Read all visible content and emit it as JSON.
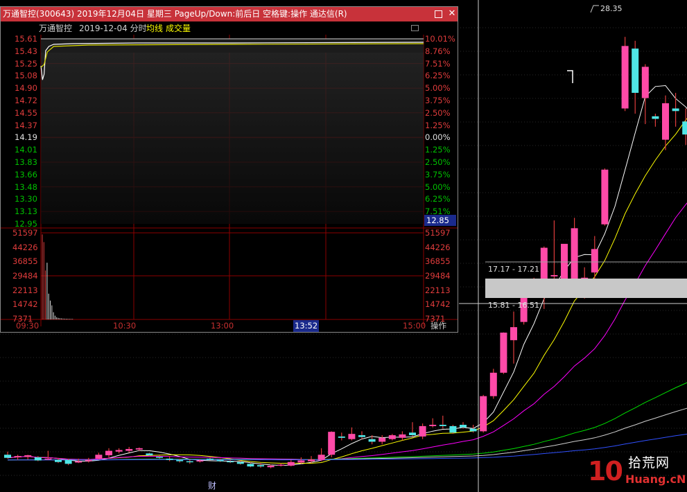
{
  "window": {
    "title": "万通智控(300643) 2019年12月04日 星期三 PageUp/Down:前后日 空格键:操作 通达信(R)",
    "restore_icon": "restore-icon",
    "close_label": "✕"
  },
  "intraday": {
    "stock_name": "万通智控",
    "date": "2019-12-04",
    "mode_label": "分时",
    "avg_label": "均线",
    "vol_label": "成交量",
    "current_price": "12.85",
    "current_time": "13:52",
    "op_label": "操作",
    "colors": {
      "up": "#e03c3c",
      "down": "#00c000",
      "flat": "#ffffff",
      "price_line": "#ffffff",
      "avg_line": "#e0e000",
      "grid": "#8c0000"
    }
  },
  "chart_data": [
    {
      "type": "line",
      "title": "",
      "xlabel": "",
      "ylabel": "",
      "x_ticks": [
        "09:30",
        "10:30",
        "13:00",
        "15:00"
      ],
      "price_ticks": [
        "15.61",
        "15.43",
        "15.25",
        "15.08",
        "14.90",
        "14.72",
        "14.55",
        "14.37",
        "14.19",
        "14.01",
        "13.83",
        "13.66",
        "13.48",
        "13.30",
        "13.13",
        "12.95"
      ],
      "pct_ticks": [
        "10.01%",
        "8.76%",
        "7.51%",
        "6.25%",
        "5.00%",
        "3.75%",
        "2.50%",
        "1.25%",
        "0.00%",
        "1.25%",
        "2.50%",
        "3.75%",
        "5.00%",
        "6.25%",
        "7.51%",
        ""
      ],
      "prev_close": 14.19,
      "ylim": [
        12.95,
        15.61
      ],
      "series": [
        {
          "name": "",
          "points": [
            [
              0,
              15.22
            ],
            [
              1,
              15.02
            ],
            [
              2,
              15.1
            ],
            [
              3,
              15.44
            ],
            [
              5,
              15.5
            ],
            [
              8,
              15.53
            ],
            [
              20,
              15.54
            ],
            [
              60,
              15.55
            ],
            [
              120,
              15.55
            ],
            [
              240,
              15.56
            ]
          ]
        },
        {
          "name": "均线",
          "points": [
            [
              0,
              15.2
            ],
            [
              2,
              15.24
            ],
            [
              4,
              15.42
            ],
            [
              8,
              15.5
            ],
            [
              30,
              15.52
            ],
            [
              120,
              15.53
            ],
            [
              240,
              15.54
            ]
          ]
        }
      ],
      "volume_ticks": [
        "51597",
        "44226",
        "36855",
        "29484",
        "22113",
        "14742",
        "7371"
      ],
      "volume_max": 51597,
      "volume_bars": [
        49500,
        45000,
        28500,
        33000,
        15000,
        11000,
        8200,
        4200,
        2200,
        1300,
        900,
        700,
        600,
        500,
        450,
        400,
        380,
        350,
        330,
        300
      ]
    },
    {
      "type": "candlestick",
      "title": "",
      "ylim": [
        11.8,
        29.5
      ],
      "price_annotations": [
        "28.35",
        "17.17 - 17.21",
        "15.81 - 16.51"
      ],
      "candles": [
        {
          "o": 12.3,
          "h": 12.42,
          "l": 12.15,
          "c": 12.18
        },
        {
          "o": 12.2,
          "h": 12.3,
          "l": 12.1,
          "c": 12.25
        },
        {
          "o": 12.22,
          "h": 12.3,
          "l": 12.12,
          "c": 12.28
        },
        {
          "o": 12.2,
          "h": 12.25,
          "l": 12.05,
          "c": 12.08
        },
        {
          "o": 12.12,
          "h": 12.45,
          "l": 12.1,
          "c": 12.15
        },
        {
          "o": 12.1,
          "h": 12.18,
          "l": 11.98,
          "c": 12.02
        },
        {
          "o": 12.1,
          "h": 12.15,
          "l": 11.9,
          "c": 11.95
        },
        {
          "o": 12.0,
          "h": 12.15,
          "l": 11.98,
          "c": 12.05
        },
        {
          "o": 12.05,
          "h": 12.18,
          "l": 12.0,
          "c": 12.1
        },
        {
          "o": 12.15,
          "h": 12.38,
          "l": 12.12,
          "c": 12.3
        },
        {
          "o": 12.28,
          "h": 12.55,
          "l": 12.2,
          "c": 12.45
        },
        {
          "o": 12.42,
          "h": 12.55,
          "l": 12.35,
          "c": 12.48
        },
        {
          "o": 12.45,
          "h": 12.6,
          "l": 12.38,
          "c": 12.52
        },
        {
          "o": 12.5,
          "h": 12.58,
          "l": 12.45,
          "c": 12.55
        },
        {
          "o": 12.35,
          "h": 12.38,
          "l": 12.25,
          "c": 12.28
        },
        {
          "o": 12.22,
          "h": 12.28,
          "l": 12.15,
          "c": 12.18
        },
        {
          "o": 12.15,
          "h": 12.25,
          "l": 12.05,
          "c": 12.1
        },
        {
          "o": 12.1,
          "h": 12.15,
          "l": 12.0,
          "c": 12.05
        },
        {
          "o": 12.05,
          "h": 12.12,
          "l": 11.95,
          "c": 12.02
        },
        {
          "o": 12.05,
          "h": 12.12,
          "l": 12.0,
          "c": 12.08
        },
        {
          "o": 12.15,
          "h": 12.2,
          "l": 12.08,
          "c": 12.1
        },
        {
          "o": 12.1,
          "h": 12.15,
          "l": 12.02,
          "c": 12.05
        },
        {
          "o": 12.05,
          "h": 12.1,
          "l": 11.98,
          "c": 12.02
        },
        {
          "o": 12.02,
          "h": 12.08,
          "l": 11.92,
          "c": 11.95
        },
        {
          "o": 11.95,
          "h": 12.0,
          "l": 11.82,
          "c": 11.85
        },
        {
          "o": 11.9,
          "h": 11.98,
          "l": 11.8,
          "c": 11.85
        },
        {
          "o": 11.82,
          "h": 11.92,
          "l": 11.78,
          "c": 11.88
        },
        {
          "o": 11.9,
          "h": 11.98,
          "l": 11.85,
          "c": 11.92
        },
        {
          "o": 11.88,
          "h": 12.1,
          "l": 11.85,
          "c": 12.02
        },
        {
          "o": 12.0,
          "h": 12.2,
          "l": 11.95,
          "c": 12.08
        },
        {
          "o": 12.05,
          "h": 12.25,
          "l": 11.98,
          "c": 12.12
        },
        {
          "o": 12.1,
          "h": 12.55,
          "l": 12.05,
          "c": 12.3
        },
        {
          "o": 12.3,
          "h": 13.2,
          "l": 12.2,
          "c": 13.18
        },
        {
          "o": 13.0,
          "h": 13.15,
          "l": 12.85,
          "c": 12.95
        },
        {
          "o": 12.9,
          "h": 13.35,
          "l": 12.85,
          "c": 13.1
        },
        {
          "o": 13.05,
          "h": 13.2,
          "l": 12.9,
          "c": 12.98
        },
        {
          "o": 12.9,
          "h": 13.05,
          "l": 12.7,
          "c": 12.8
        },
        {
          "o": 12.8,
          "h": 13.05,
          "l": 12.7,
          "c": 12.95
        },
        {
          "o": 12.9,
          "h": 13.1,
          "l": 12.85,
          "c": 13.05
        },
        {
          "o": 12.95,
          "h": 13.2,
          "l": 12.85,
          "c": 13.08
        },
        {
          "o": 13.15,
          "h": 13.55,
          "l": 13.0,
          "c": 13.05
        },
        {
          "o": 13.0,
          "h": 13.5,
          "l": 12.9,
          "c": 13.4
        },
        {
          "o": 13.4,
          "h": 13.7,
          "l": 13.35,
          "c": 13.45
        },
        {
          "o": 13.45,
          "h": 13.8,
          "l": 13.3,
          "c": 13.4
        },
        {
          "o": 13.4,
          "h": 13.45,
          "l": 13.1,
          "c": 13.15
        },
        {
          "o": 13.45,
          "h": 13.55,
          "l": 13.3,
          "c": 13.35
        },
        {
          "o": 13.3,
          "h": 13.45,
          "l": 13.15,
          "c": 13.2
        },
        {
          "o": 13.2,
          "h": 14.6,
          "l": 13.15,
          "c": 14.55
        },
        {
          "o": 14.55,
          "h": 15.6,
          "l": 14.45,
          "c": 15.45
        },
        {
          "o": 15.45,
          "h": 17.0,
          "l": 15.4,
          "c": 16.99
        },
        {
          "o": 16.7,
          "h": 17.8,
          "l": 15.8,
          "c": 17.2
        },
        {
          "o": 17.4,
          "h": 18.8,
          "l": 17.3,
          "c": 18.5
        },
        {
          "o": 18.5,
          "h": 19.1,
          "l": 18.4,
          "c": 18.52
        },
        {
          "o": 19.0,
          "h": 20.3,
          "l": 17.9,
          "c": 20.25
        },
        {
          "o": 19.15,
          "h": 21.3,
          "l": 18.75,
          "c": 19.2
        },
        {
          "o": 18.85,
          "h": 20.3,
          "l": 18.5,
          "c": 20.4
        },
        {
          "o": 18.9,
          "h": 21.4,
          "l": 18.4,
          "c": 21.0
        },
        {
          "o": 18.8,
          "h": 19.5,
          "l": 18.3,
          "c": 19.1
        },
        {
          "o": 19.3,
          "h": 20.7,
          "l": 18.7,
          "c": 20.2
        },
        {
          "o": 21.15,
          "h": 23.3,
          "l": 21.1,
          "c": 23.25
        },
        {
          "o": null,
          "h": null,
          "l": null,
          "c": null
        },
        {
          "o": 25.6,
          "h": 28.35,
          "l": 25.5,
          "c": 28.0
        },
        {
          "o": 27.9,
          "h": 28.2,
          "l": 25.4,
          "c": 26.2
        },
        {
          "o": 26.0,
          "h": 27.3,
          "l": 25.0,
          "c": 27.2
        },
        {
          "o": 25.3,
          "h": 25.4,
          "l": 24.9,
          "c": 25.2
        },
        {
          "o": 24.4,
          "h": 26.1,
          "l": 24.0,
          "c": 25.8
        },
        {
          "o": 25.6,
          "h": 26.2,
          "l": 24.9,
          "c": 25.5
        },
        {
          "o": 25.1,
          "h": 25.6,
          "l": 24.2,
          "c": 24.6
        },
        {
          "o": 23.4,
          "h": 25.6,
          "l": 23.3,
          "c": 24.8
        },
        {
          "o": 24.2,
          "h": 24.5,
          "l": 23.1,
          "c": 23.55
        },
        {
          "o": 23.6,
          "h": 24.3,
          "l": 22.9,
          "c": 23.2
        },
        {
          "o": 23.25,
          "h": 23.3,
          "l": 23.05,
          "c": 23.1
        },
        {
          "o": 23.3,
          "h": 24.1,
          "l": 23.1,
          "c": 23.5
        },
        {
          "o": 23.45,
          "h": 24.2,
          "l": 23.2,
          "c": 23.8
        }
      ]
    }
  ],
  "markers": {
    "fin_label": "财"
  },
  "watermark": {
    "number": "10",
    "cn": "拾荒网",
    "en": "Huang.cN"
  }
}
